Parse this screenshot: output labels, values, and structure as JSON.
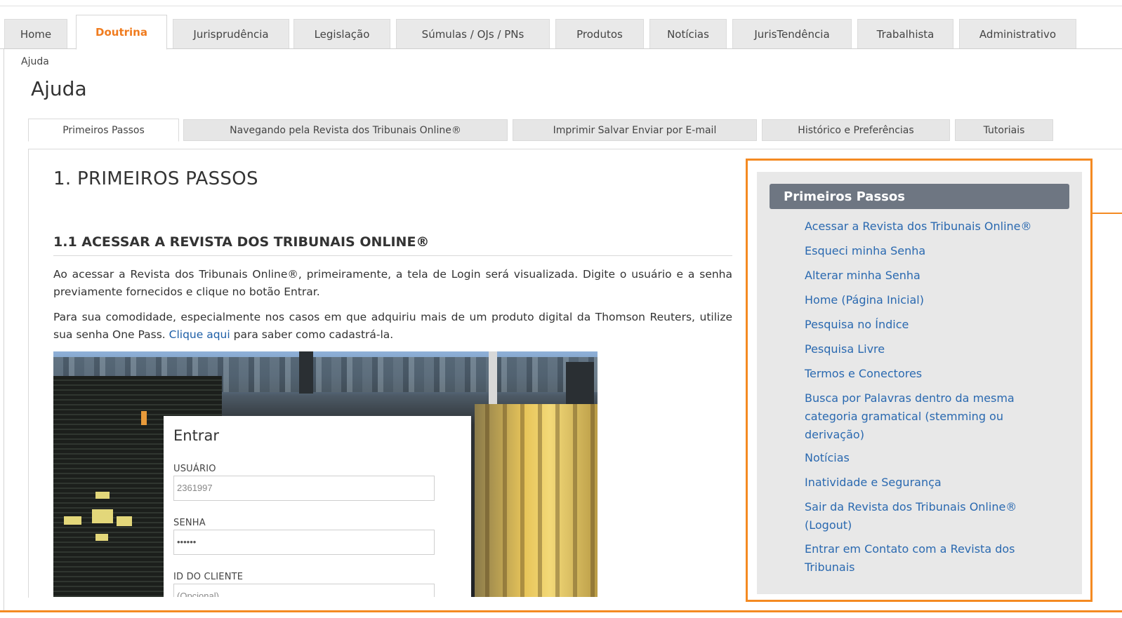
{
  "top_tabs": [
    "Home",
    "Doutrina",
    "Jurisprudência",
    "Legislação",
    "Súmulas / OJs / PNs",
    "Produtos",
    "Notícias",
    "JurisTendência",
    "Trabalhista",
    "Administrativo"
  ],
  "active_top_tab": "Doutrina",
  "breadcrumb": "Ajuda",
  "page_title": "Ajuda",
  "sub_tabs": [
    "Primeiros Passos",
    "Navegando pela Revista dos Tribunais Online®",
    "Imprimir Salvar Enviar por E-mail",
    "Histórico e Preferências",
    "Tutoriais"
  ],
  "active_sub_tab": "Primeiros Passos",
  "section_title": "1. PRIMEIROS PASSOS",
  "subsection_title": "1.1 ACESSAR A REVISTA DOS TRIBUNAIS ONLINE®",
  "paragraph1": "Ao acessar a Revista dos Tribunais Online®, primeiramente, a tela de Login será visualizada. Digite o usuário e a senha previamente fornecidos e clique no botão Entrar.",
  "paragraph2": {
    "before": "Para sua comodidade, especialmente nos casos em que adquiriu mais de um produto digital da Thomson Reuters, utilize sua senha One Pass. ",
    "link": "Clique aqui",
    "after": " para saber como cadastrá-la."
  },
  "login_screenshot": {
    "title": "Entrar",
    "user_label": "USUÁRIO",
    "user_value": "2361997",
    "password_label": "SENHA",
    "password_value": "••••••",
    "client_label": "ID DO CLIENTE",
    "client_placeholder": "(Opcional)"
  },
  "side_panel": {
    "title": "Primeiros Passos",
    "links": [
      "Acessar a Revista dos Tribunais Online®",
      "Esqueci minha Senha",
      "Alterar minha Senha",
      "Home (Página Inicial)",
      "Pesquisa no Índice",
      "Pesquisa Livre",
      "Termos e Conectores",
      "Busca por Palavras dentro da mesma categoria gramatical (stemming ou derivação)",
      "Notícias",
      "Inatividade e Segurança",
      "Sair da Revista dos Tribunais Online® (Logout)",
      "Entrar em Contato com a Revista dos Tribunais"
    ]
  },
  "colors": {
    "accent_orange": "#f48a22",
    "active_tab_text": "#f07c1f",
    "link_blue": "#2a69b0",
    "panel_header": "#6e7682"
  }
}
